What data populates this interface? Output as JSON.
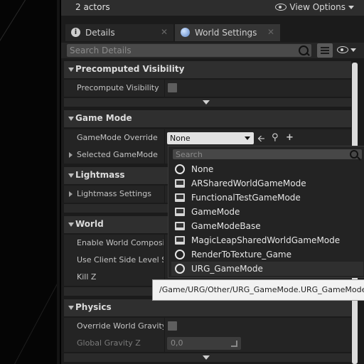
{
  "header": {
    "actors_count": "2 actors",
    "view_options_label": "View Options"
  },
  "tabs": [
    {
      "label": "Details",
      "close": "✕"
    },
    {
      "label": "World Settings",
      "close": "✕"
    }
  ],
  "search": {
    "placeholder": "Search Details"
  },
  "sections": {
    "precomputed": {
      "title": "Precomputed Visibility",
      "rows": [
        {
          "label": "Precompute Visibility",
          "checked": false
        }
      ]
    },
    "game_mode": {
      "title": "Game Mode",
      "rows": [
        {
          "label": "GameMode Override",
          "value": "None"
        },
        {
          "label": "Selected GameMode"
        }
      ]
    },
    "lightmass": {
      "title": "Lightmass",
      "rows": [
        {
          "label": "Lightmass Settings"
        }
      ]
    },
    "world": {
      "title": "World",
      "rows": [
        {
          "label": "Enable World Composition"
        },
        {
          "label": "Use Client Side Level Streaming Volumes"
        },
        {
          "label": "Kill Z"
        }
      ]
    },
    "physics": {
      "title": "Physics",
      "rows": [
        {
          "label": "Override World Gravity",
          "checked": false
        },
        {
          "label": "Global Gravity Z",
          "value": "0,0"
        }
      ]
    }
  },
  "dropdown": {
    "search_placeholder": "Search",
    "items": [
      {
        "label": "None",
        "icon": "circle-icon"
      },
      {
        "label": "ARSharedWorldGameMode",
        "icon": "blueprint-icon"
      },
      {
        "label": "FunctionalTestGameMode",
        "icon": "blueprint-icon"
      },
      {
        "label": "GameMode",
        "icon": "blueprint-icon"
      },
      {
        "label": "GameModeBase",
        "icon": "blueprint-icon"
      },
      {
        "label": "MagicLeapSharedWorldGameMode",
        "icon": "blueprint-icon"
      },
      {
        "label": "RenderToTexture_Game",
        "icon": "circle-icon"
      },
      {
        "label": "URG_GameMode",
        "icon": "circle-icon"
      }
    ],
    "tooltip": "/Game/URG/Other/URG_GameMode.URG_GameMode_C"
  }
}
